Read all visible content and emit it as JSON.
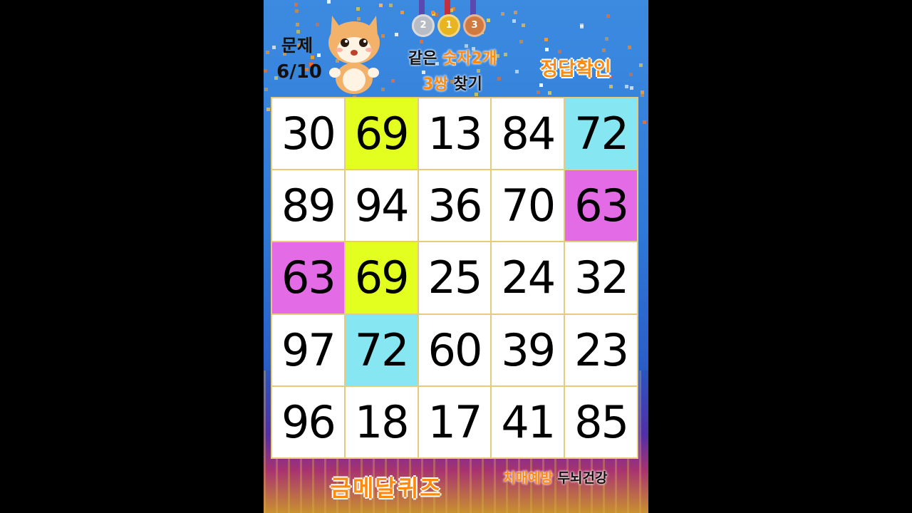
{
  "header": {
    "problem_label": "문제",
    "problem_count": "6/10",
    "title_line1_a": "같은 ",
    "title_line1_b": "숫자2개",
    "title_line2_a": "3쌍",
    "title_line2_b": " 찾기",
    "answer_button": "정답확인",
    "medals": [
      "2",
      "1",
      "3"
    ]
  },
  "grid": {
    "cells": [
      {
        "value": "30",
        "color": "#ffffff"
      },
      {
        "value": "69",
        "color": "#e3ff1f"
      },
      {
        "value": "13",
        "color": "#ffffff"
      },
      {
        "value": "84",
        "color": "#ffffff"
      },
      {
        "value": "72",
        "color": "#86e6f2"
      },
      {
        "value": "89",
        "color": "#ffffff"
      },
      {
        "value": "94",
        "color": "#ffffff"
      },
      {
        "value": "36",
        "color": "#ffffff"
      },
      {
        "value": "70",
        "color": "#ffffff"
      },
      {
        "value": "63",
        "color": "#e36be6"
      },
      {
        "value": "63",
        "color": "#e36be6"
      },
      {
        "value": "69",
        "color": "#e3ff1f"
      },
      {
        "value": "25",
        "color": "#ffffff"
      },
      {
        "value": "24",
        "color": "#ffffff"
      },
      {
        "value": "32",
        "color": "#ffffff"
      },
      {
        "value": "97",
        "color": "#ffffff"
      },
      {
        "value": "72",
        "color": "#86e6f2"
      },
      {
        "value": "60",
        "color": "#ffffff"
      },
      {
        "value": "39",
        "color": "#ffffff"
      },
      {
        "value": "23",
        "color": "#ffffff"
      },
      {
        "value": "96",
        "color": "#ffffff"
      },
      {
        "value": "18",
        "color": "#ffffff"
      },
      {
        "value": "17",
        "color": "#ffffff"
      },
      {
        "value": "41",
        "color": "#ffffff"
      },
      {
        "value": "85",
        "color": "#ffffff"
      }
    ]
  },
  "footer": {
    "brand": "금메달퀴즈",
    "slogan_a": "치매예방",
    "slogan_b": " 두뇌건강"
  },
  "colors": {
    "accent_orange": "#ff8a10",
    "grid_border": "#e6cc7a",
    "medal_silver": "#b8bcc4",
    "medal_gold": "#e8b420",
    "medal_bronze": "#d07a40"
  }
}
